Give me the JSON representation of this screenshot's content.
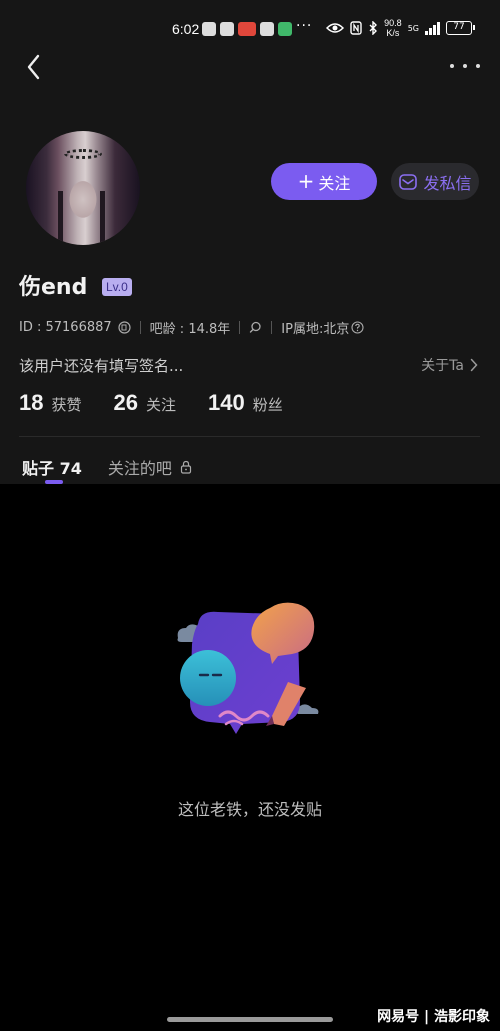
{
  "status_bar": {
    "time": "6:02",
    "more": "···",
    "net_speed_value": "90.8",
    "net_speed_unit": "K/s",
    "network": "5G",
    "battery": "77"
  },
  "profile": {
    "username": "伤end",
    "level": "Lv.0",
    "id_text": "ID : 57166887",
    "bar_age": "吧龄 : 14.8年",
    "ip_location": "IP属地:北京",
    "signature": "该用户还没有填写签名...",
    "about_link": "关于Ta"
  },
  "actions": {
    "follow_plus": "+",
    "follow_label": "关注",
    "dm_label": "发私信"
  },
  "stats": [
    {
      "value": "18",
      "label": "获赞"
    },
    {
      "value": "26",
      "label": "关注"
    },
    {
      "value": "140",
      "label": "粉丝"
    }
  ],
  "tabs": [
    {
      "label": "贴子 74"
    },
    {
      "label": "关注的吧"
    }
  ],
  "empty_state": {
    "message": "这位老铁，还没发贴"
  },
  "watermark": "网易号 | 浩影印象",
  "colors": {
    "accent": "#7b5cf0",
    "header_bg": "#161616",
    "body_bg": "#000000"
  }
}
